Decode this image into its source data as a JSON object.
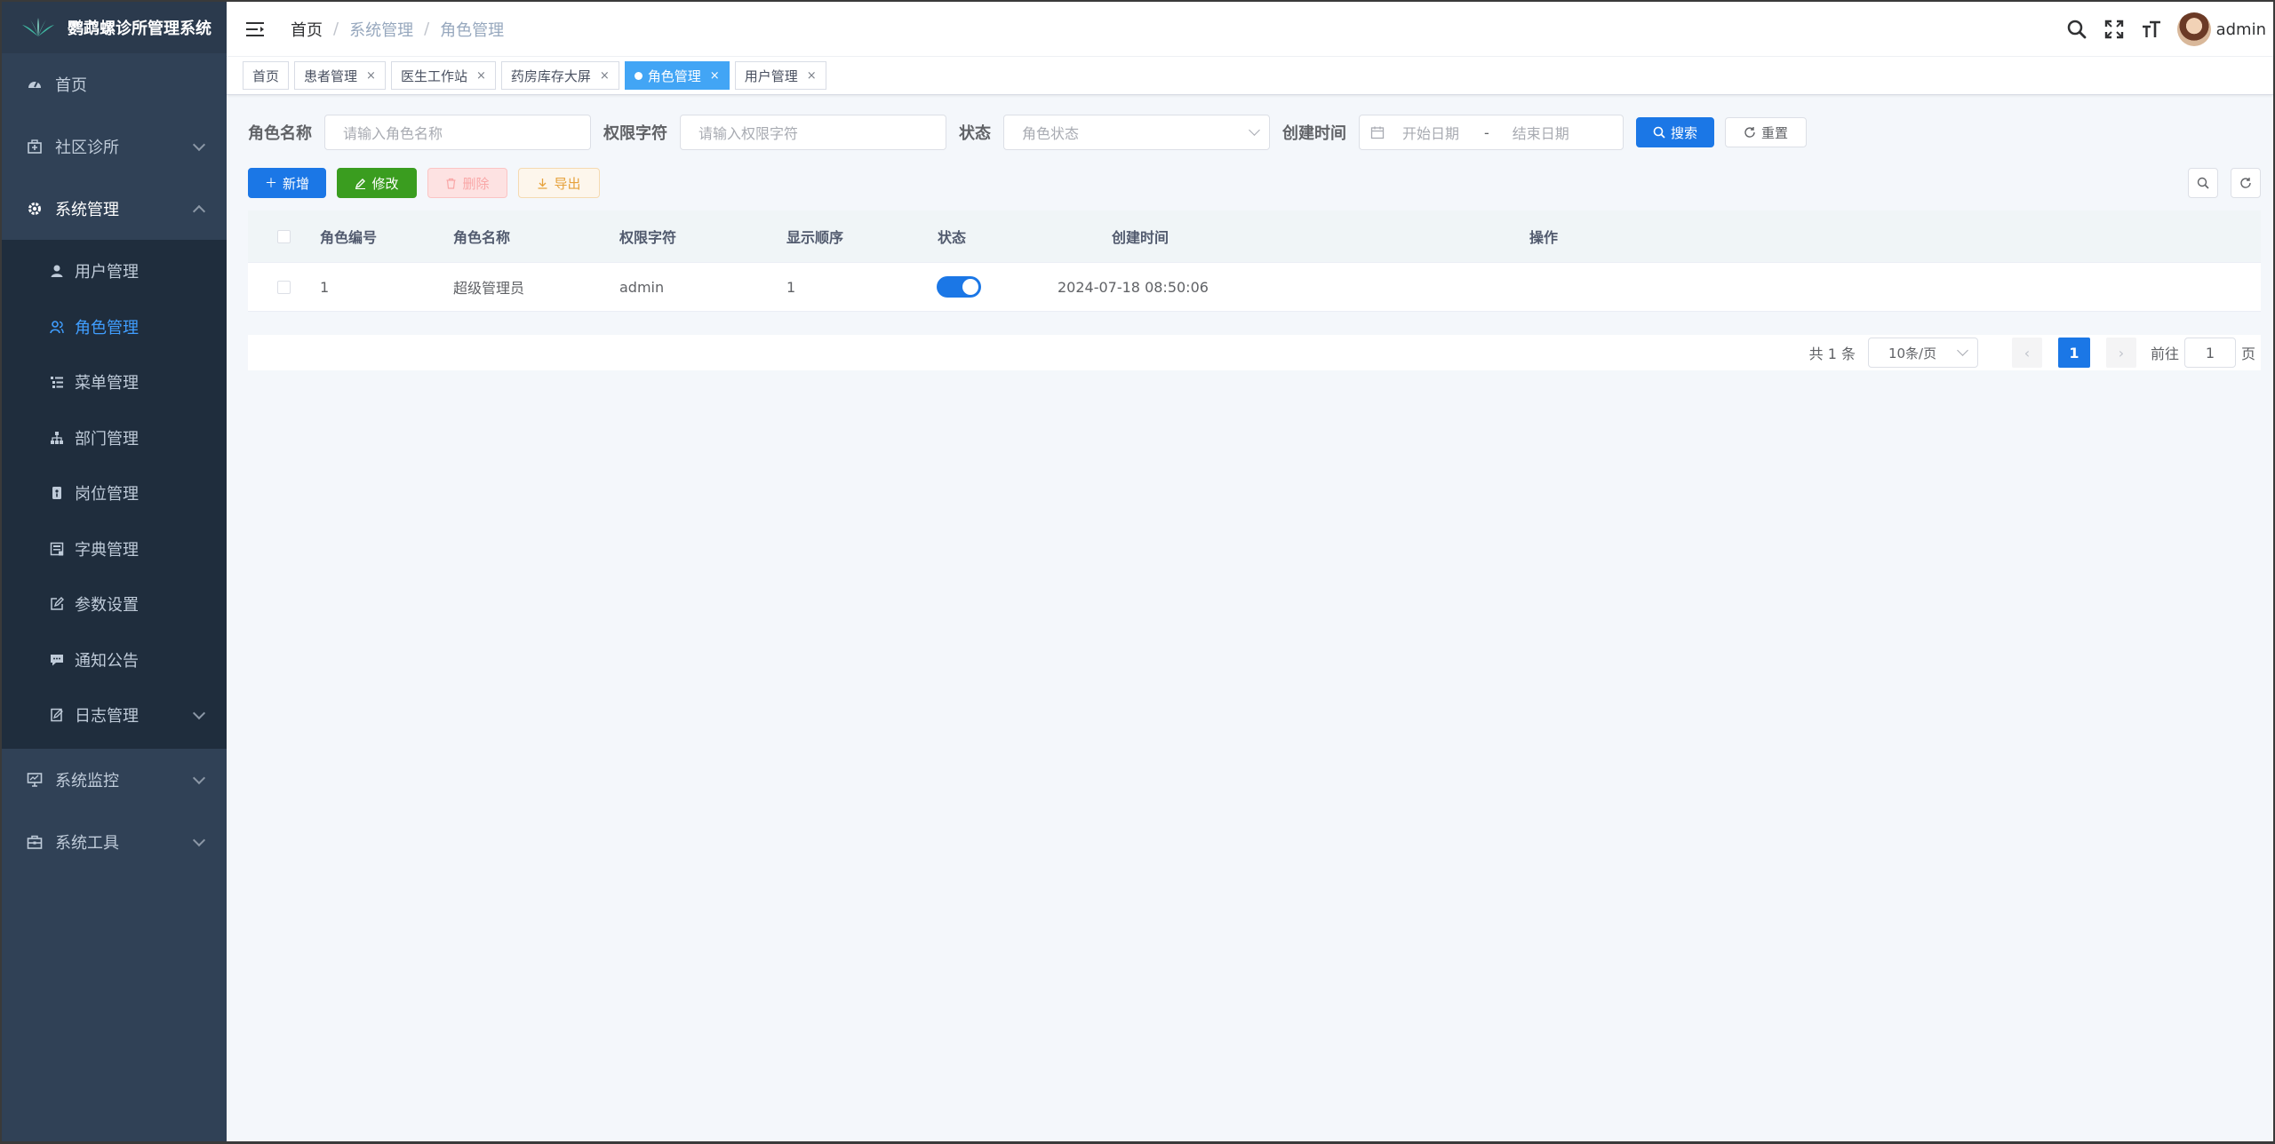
{
  "app": {
    "title": "鹦鹉螺诊所管理系统"
  },
  "sidebar": {
    "items": [
      {
        "label": "首页",
        "icon": "dashboard-icon"
      },
      {
        "label": "社区诊所",
        "icon": "hospital-icon"
      },
      {
        "label": "系统管理",
        "icon": "gear-icon"
      },
      {
        "label": "系统监控",
        "icon": "monitor-icon"
      },
      {
        "label": "系统工具",
        "icon": "toolbox-icon"
      }
    ],
    "sub_items": [
      {
        "label": "用户管理",
        "icon": "user-icon"
      },
      {
        "label": "角色管理",
        "icon": "peoples-icon"
      },
      {
        "label": "菜单管理",
        "icon": "tree-table-icon"
      },
      {
        "label": "部门管理",
        "icon": "tree-icon"
      },
      {
        "label": "岗位管理",
        "icon": "post-icon"
      },
      {
        "label": "字典管理",
        "icon": "dict-icon"
      },
      {
        "label": "参数设置",
        "icon": "edit-icon"
      },
      {
        "label": "通知公告",
        "icon": "message-icon"
      },
      {
        "label": "日志管理",
        "icon": "log-icon"
      }
    ]
  },
  "breadcrumb": [
    "首页",
    "系统管理",
    "角色管理"
  ],
  "header": {
    "username": "admin"
  },
  "tags": [
    {
      "label": "首页"
    },
    {
      "label": "患者管理"
    },
    {
      "label": "医生工作站"
    },
    {
      "label": "药房库存大屏"
    },
    {
      "label": "角色管理"
    },
    {
      "label": "用户管理"
    }
  ],
  "search": {
    "role_name_label": "角色名称",
    "role_name_placeholder": "请输入角色名称",
    "role_key_label": "权限字符",
    "role_key_placeholder": "请输入权限字符",
    "status_label": "状态",
    "status_placeholder": "角色状态",
    "time_label": "创建时间",
    "start_placeholder": "开始日期",
    "range_sep": "-",
    "end_placeholder": "结束日期",
    "search_btn": "搜索",
    "reset_btn": "重置"
  },
  "toolbar": {
    "add": "新增",
    "edit": "修改",
    "delete": "删除",
    "export": "导出"
  },
  "table": {
    "columns": [
      "角色编号",
      "角色名称",
      "权限字符",
      "显示顺序",
      "状态",
      "创建时间",
      "操作"
    ],
    "rows": [
      {
        "id": "1",
        "name": "超级管理员",
        "key": "admin",
        "sort": "1",
        "status": true,
        "time": "2024-07-18 08:50:06"
      }
    ]
  },
  "pagination": {
    "total": "共 1 条",
    "page_size": "10条/页",
    "current": "1",
    "goto_label": "前往",
    "goto_value": "1",
    "page_suffix": "页"
  },
  "colors": {
    "primary": "#1b77e6",
    "sidebar_bg": "#304156",
    "active_menu": "#409eff"
  }
}
